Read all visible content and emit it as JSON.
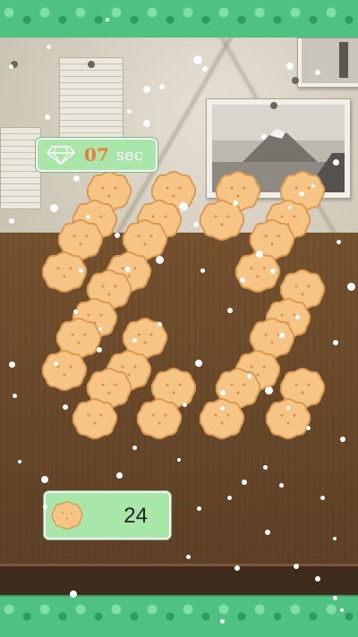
{
  "timer": {
    "seconds": "07",
    "unit": "sec",
    "icon": "diamond-icon"
  },
  "counter": {
    "value": "24",
    "icon": "cookie-icon"
  },
  "colors": {
    "panel": "#a9e6a9",
    "timer_digits": "#ef7a3b",
    "band": "#4fc282"
  }
}
